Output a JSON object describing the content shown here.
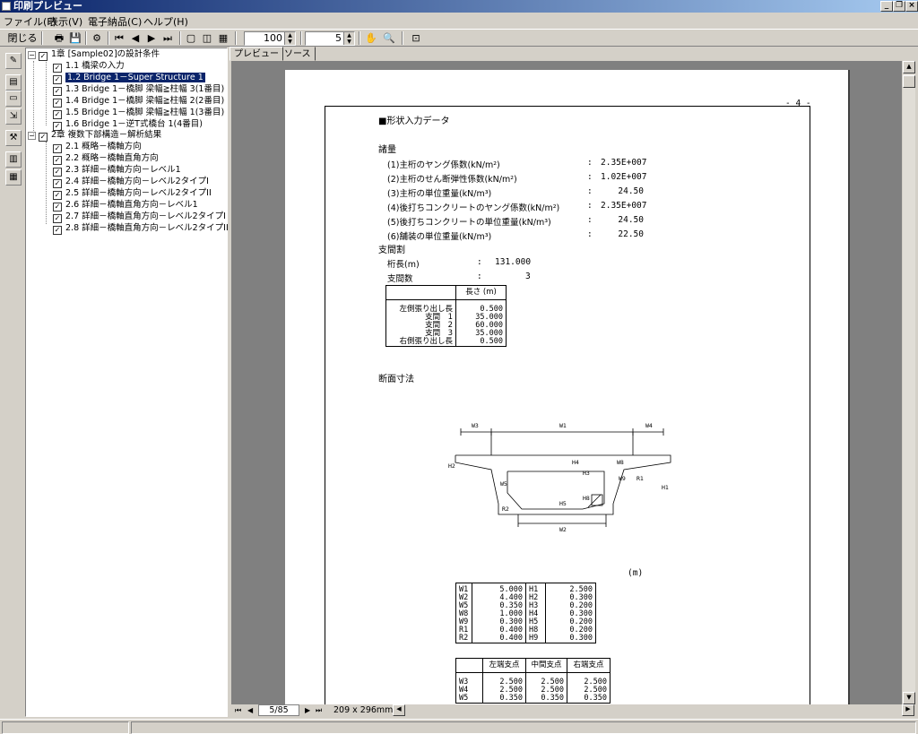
{
  "window": {
    "title": "印刷プレビュー"
  },
  "menu": [
    "ファイル(F)",
    "表示(V)",
    "電子納品(C)",
    "ヘルプ(H)"
  ],
  "toolbar": {
    "close_label": "閉じる",
    "zoom": "100",
    "pages": "5"
  },
  "tree": {
    "ch1": "1章 [Sample02]の設計条件",
    "ch1_items": [
      "1.1 橋梁の入力",
      "1.2 Bridge 1－Super Structure 1",
      "1.3 Bridge 1－橋脚 梁幅≧柱幅 3(1番目)",
      "1.4 Bridge 1－橋脚 梁幅≧柱幅 2(2番目)",
      "1.5 Bridge 1－橋脚 梁幅≧柱幅 1(3番目)",
      "1.6 Bridge 1－逆T式橋台 1(4番目)"
    ],
    "ch2": "2章 複数下部構造－解析結果",
    "ch2_items": [
      "2.1 概略－橋軸方向",
      "2.2 概略－橋軸直角方向",
      "2.3 詳細－橋軸方向－レベル1",
      "2.4 詳細－橋軸方向－レベル2タイプI",
      "2.5 詳細－橋軸方向－レベル2タイプII",
      "2.6 詳細－橋軸直角方向－レベル1",
      "2.7 詳細－橋軸直角方向－レベル2タイプI",
      "2.8 詳細－橋軸直角方向－レベル2タイプII"
    ]
  },
  "tabs": [
    "プレビュー",
    "ソース"
  ],
  "doc": {
    "page_no": "- 4 -",
    "heading": "■形状入力データ",
    "sec_specs": "諸量",
    "specs": [
      {
        "label": "(1)主桁のヤング係数(kN/m²)",
        "sep": ":",
        "value": "2.35E+007"
      },
      {
        "label": "(2)主桁のせん断弾性係数(kN/m²)",
        "sep": ":",
        "value": "1.02E+007"
      },
      {
        "label": "(3)主桁の単位重量(kN/m³)",
        "sep": ":",
        "value": "24.50"
      },
      {
        "label": "(4)後打ちコンクリートのヤング係数(kN/m²)",
        "sep": ":",
        "value": "2.35E+007"
      },
      {
        "label": "(5)後打ちコンクリートの単位重量(kN/m³)",
        "sep": ":",
        "value": "24.50"
      },
      {
        "label": "(6)舗装の単位重量(kN/m³)",
        "sep": ":",
        "value": "22.50"
      }
    ],
    "sec_span": "支間割",
    "girder_len_label": "桁長(m)",
    "girder_len_value": "131.000",
    "span_count_label": "支間数",
    "span_count_value": "3",
    "span_table": {
      "header": "長さ (m)",
      "rows": [
        {
          "label": "左側張り出し長",
          "value": "0.500"
        },
        {
          "label": "支間　1",
          "value": "35.000"
        },
        {
          "label": "支間　2",
          "value": "60.000"
        },
        {
          "label": "支間　3",
          "value": "35.000"
        },
        {
          "label": "右側張り出し長",
          "value": "0.500"
        }
      ]
    },
    "sec_section": "断面寸法",
    "unit": "(m)",
    "diagram_labels": [
      "W3",
      "W1",
      "W4",
      "W8",
      "H4",
      "H3",
      "H2",
      "W5",
      "W9",
      "R1",
      "H1",
      "H5",
      "H8",
      "R2",
      "W2"
    ],
    "dims_table": {
      "left": [
        {
          "k": "W1",
          "v": "5.000"
        },
        {
          "k": "W2",
          "v": "4.400"
        },
        {
          "k": "W5",
          "v": "0.350"
        },
        {
          "k": "W8",
          "v": "1.000"
        },
        {
          "k": "W9",
          "v": "0.300"
        },
        {
          "k": "R1",
          "v": "0.400"
        },
        {
          "k": "R2",
          "v": "0.400"
        }
      ],
      "right": [
        {
          "k": "H1",
          "v": "2.500"
        },
        {
          "k": "H2",
          "v": "0.300"
        },
        {
          "k": "H3",
          "v": "0.200"
        },
        {
          "k": "H4",
          "v": "0.300"
        },
        {
          "k": "H5",
          "v": "0.200"
        },
        {
          "k": "H8",
          "v": "0.200"
        },
        {
          "k": "H9",
          "v": "0.300"
        }
      ]
    },
    "support_table": {
      "headers": [
        "左端支点",
        "中間支点",
        "右端支点"
      ],
      "rows": [
        {
          "k": "W3",
          "v": [
            "2.500",
            "2.500",
            "2.500"
          ]
        },
        {
          "k": "W4",
          "v": [
            "2.500",
            "2.500",
            "2.500"
          ]
        },
        {
          "k": "W5",
          "v": [
            "0.350",
            "0.350",
            "0.350"
          ]
        }
      ]
    }
  },
  "nav": {
    "page": "5/85",
    "size": "209 x 296mm"
  }
}
